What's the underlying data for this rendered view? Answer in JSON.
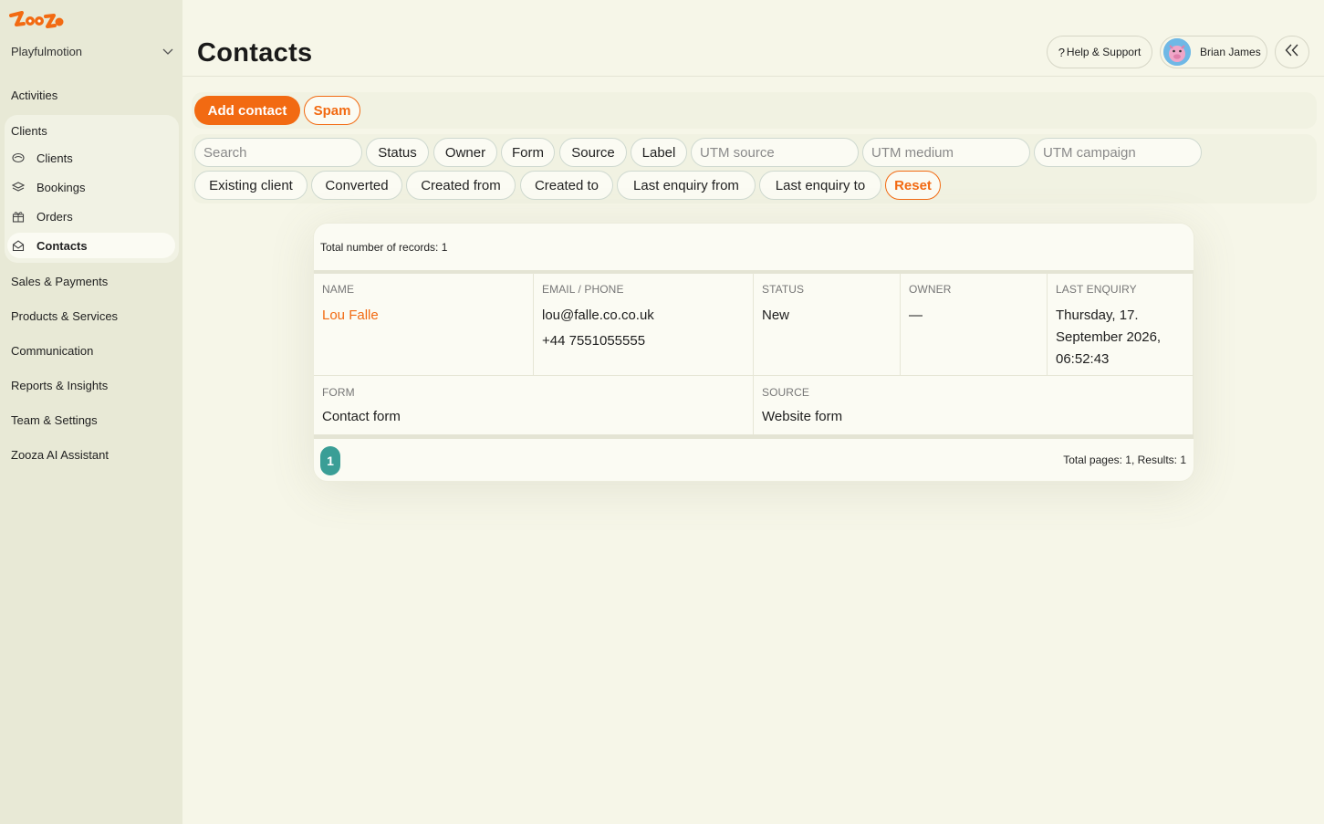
{
  "sidebar": {
    "brand": "Zooza",
    "org_name": "Playfulmotion",
    "items": {
      "activities": "Activities",
      "clients_group": "Clients",
      "sales": "Sales & Payments",
      "products": "Products & Services",
      "communication": "Communication",
      "reports": "Reports & Insights",
      "team": "Team & Settings",
      "ai": "Zooza AI Assistant"
    },
    "clients_sub": {
      "clients": "Clients",
      "bookings": "Bookings",
      "orders": "Orders",
      "contacts": "Contacts"
    },
    "active_item": "Contacts"
  },
  "header": {
    "title": "Contacts",
    "help_label": "Help & Support",
    "user_name": "Brian James"
  },
  "actions": {
    "add_contact": "Add contact",
    "spam": "Spam"
  },
  "filters": {
    "search_placeholder": "Search",
    "status": "Status",
    "owner": "Owner",
    "form": "Form",
    "source": "Source",
    "label": "Label",
    "utm_source": "UTM source",
    "utm_medium": "UTM medium",
    "utm_campaign": "UTM campaign",
    "existing_client": "Existing client",
    "converted": "Converted",
    "created_from": "Created from",
    "created_to": "Created to",
    "last_enquiry_from": "Last enquiry from",
    "last_enquiry_to": "Last enquiry to",
    "reset": "Reset"
  },
  "table": {
    "records_text": "Total number of records: 1",
    "headers": {
      "name": "NAME",
      "email_phone": "EMAIL / PHONE",
      "status": "STATUS",
      "owner": "OWNER",
      "last_enquiry": "LAST ENQUIRY",
      "form": "FORM",
      "source": "SOURCE"
    },
    "rows": [
      {
        "name": "Lou Falle",
        "email": "lou@falle.co.co.uk",
        "phone": "+44 7551055555",
        "status": "New",
        "owner": "—",
        "last_enquiry": "Thursday, 17. September 2026, 06:52:43",
        "form": "Contact form",
        "source": "Website form"
      }
    ],
    "current_page": "1",
    "totals_text": "Total pages: 1, Results: 1"
  },
  "colors": {
    "accent": "#f26a12",
    "page_active": "#3a9e96",
    "sidebar_bg": "#e8e9d6",
    "page_bg": "#f6f6e8"
  }
}
